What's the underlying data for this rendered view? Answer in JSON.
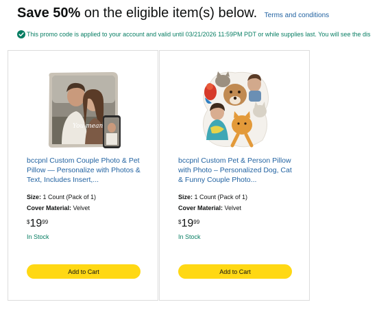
{
  "header": {
    "bold": "Save 50%",
    "rest": " on the eligible item(s) below.",
    "terms": "Terms and conditions"
  },
  "promo": {
    "icon": "check-circle-icon",
    "text": "This promo code is applied to your account and valid until 03/21/2026 11:59PM PDT or while supplies last. You will see the dis"
  },
  "products": [
    {
      "title": "bccpnl Custom Couple Photo & Pet Pillow — Personalize with Photos & Text, Includes Insert,...",
      "size_label": "Size:",
      "size_value": " 1 Count (Pack of 1)",
      "material_label": "Cover Material:",
      "material_value": " Velvet",
      "price_symbol": "$",
      "price_whole": "19",
      "price_fraction": "99",
      "stock": "In Stock",
      "button": "Add to Cart",
      "image_overlay_text": "You mean a lot to me"
    },
    {
      "title": "bccpnl Custom Pet & Person Pillow with Photo – Personalized Dog, Cat & Funny Couple Photo...",
      "size_label": "Size:",
      "size_value": " 1 Count (Pack of 1)",
      "material_label": "Cover Material:",
      "material_value": " Velvet",
      "price_symbol": "$",
      "price_whole": "19",
      "price_fraction": "99",
      "stock": "In Stock",
      "button": "Add to Cart"
    }
  ],
  "colors": {
    "link": "#2162a1",
    "success": "#067d62",
    "button": "#ffd814"
  }
}
